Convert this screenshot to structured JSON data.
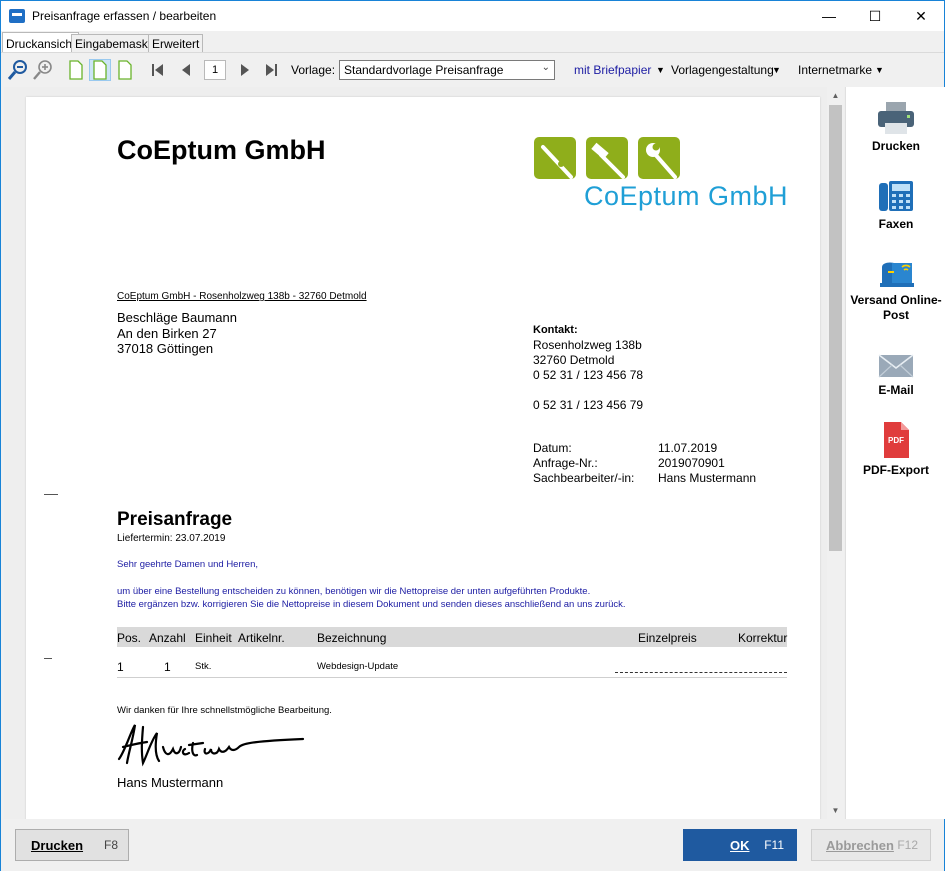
{
  "window": {
    "title": "Preisanfrage  erfassen / bearbeiten"
  },
  "tabs": [
    {
      "label": "Druckansicht"
    },
    {
      "label": "Eingabemaske"
    },
    {
      "label": "Erweitert"
    }
  ],
  "toolbar": {
    "page": "1",
    "vorlage_label": "Vorlage:",
    "vorlage_value": "Standardvorlage Preisanfrage",
    "briefpapier": "mit Briefpapier",
    "vorlagengestaltung": "Vorlagengestaltung",
    "internetmarke": "Internetmarke"
  },
  "document": {
    "company": "CoEptum GmbH",
    "logo_text": "CoEptum GmbH",
    "sender_line": "CoEptum GmbH - Rosenholzweg 138b - 32760 Detmold",
    "recipient": [
      "Beschläge Baumann",
      "An den Birken 27",
      "37018 Göttingen"
    ],
    "contact_label": "Kontakt:",
    "contact": [
      "Rosenholzweg 138b",
      "32760 Detmold",
      "0 52 31 / 123 456 78",
      "",
      "0 52 31 / 123 456 79"
    ],
    "meta": [
      {
        "k": "Datum:",
        "v": "11.07.2019"
      },
      {
        "k": "Anfrage-Nr.:",
        "v": "2019070901"
      },
      {
        "k": "Sachbearbeiter/-in:",
        "v": "Hans Mustermann"
      }
    ],
    "heading": "Preisanfrage",
    "liefertermin": "Liefertermin:  23.07.2019",
    "salutation": "Sehr geehrte Damen und Herren,",
    "paragraph": [
      "um über eine Bestellung entscheiden zu können, benötigen wir die Nettopreise der unten aufgeführten Produkte.",
      "Bitte ergänzen bzw. korrigieren Sie die Nettopreise in diesem Dokument und senden dieses anschließend an uns zurück."
    ],
    "table": {
      "headers": [
        "Pos.",
        "Anzahl",
        "Einheit",
        "Artikelnr.",
        "Bezeichnung",
        "Einzelpreis",
        "Korrektur"
      ],
      "rows": [
        {
          "pos": "1",
          "anzahl": "1",
          "einheit": "Stk.",
          "artikelnr": "",
          "bezeichnung": "Webdesign-Update"
        }
      ]
    },
    "thanks": "Wir danken für Ihre schnellstmögliche Bearbeitung.",
    "signer": "Hans Mustermann"
  },
  "side": [
    {
      "label": "Drucken"
    },
    {
      "label": "Faxen"
    },
    {
      "label": "Versand Online-Post"
    },
    {
      "label": "E-Mail"
    },
    {
      "label": "PDF-Export"
    }
  ],
  "pdf_badge": "PDF",
  "buttons": {
    "print": {
      "label": "Drucken",
      "key": "F8"
    },
    "ok": {
      "label": "OK",
      "key": "F11"
    },
    "cancel": {
      "label": "Abbrechen",
      "key": "F12"
    }
  },
  "colors": {
    "accent": "#1f5aa0",
    "logo_green": "#8fae1b",
    "logo_blue": "#1f9fd6",
    "link_blue": "#1c1ca3"
  }
}
